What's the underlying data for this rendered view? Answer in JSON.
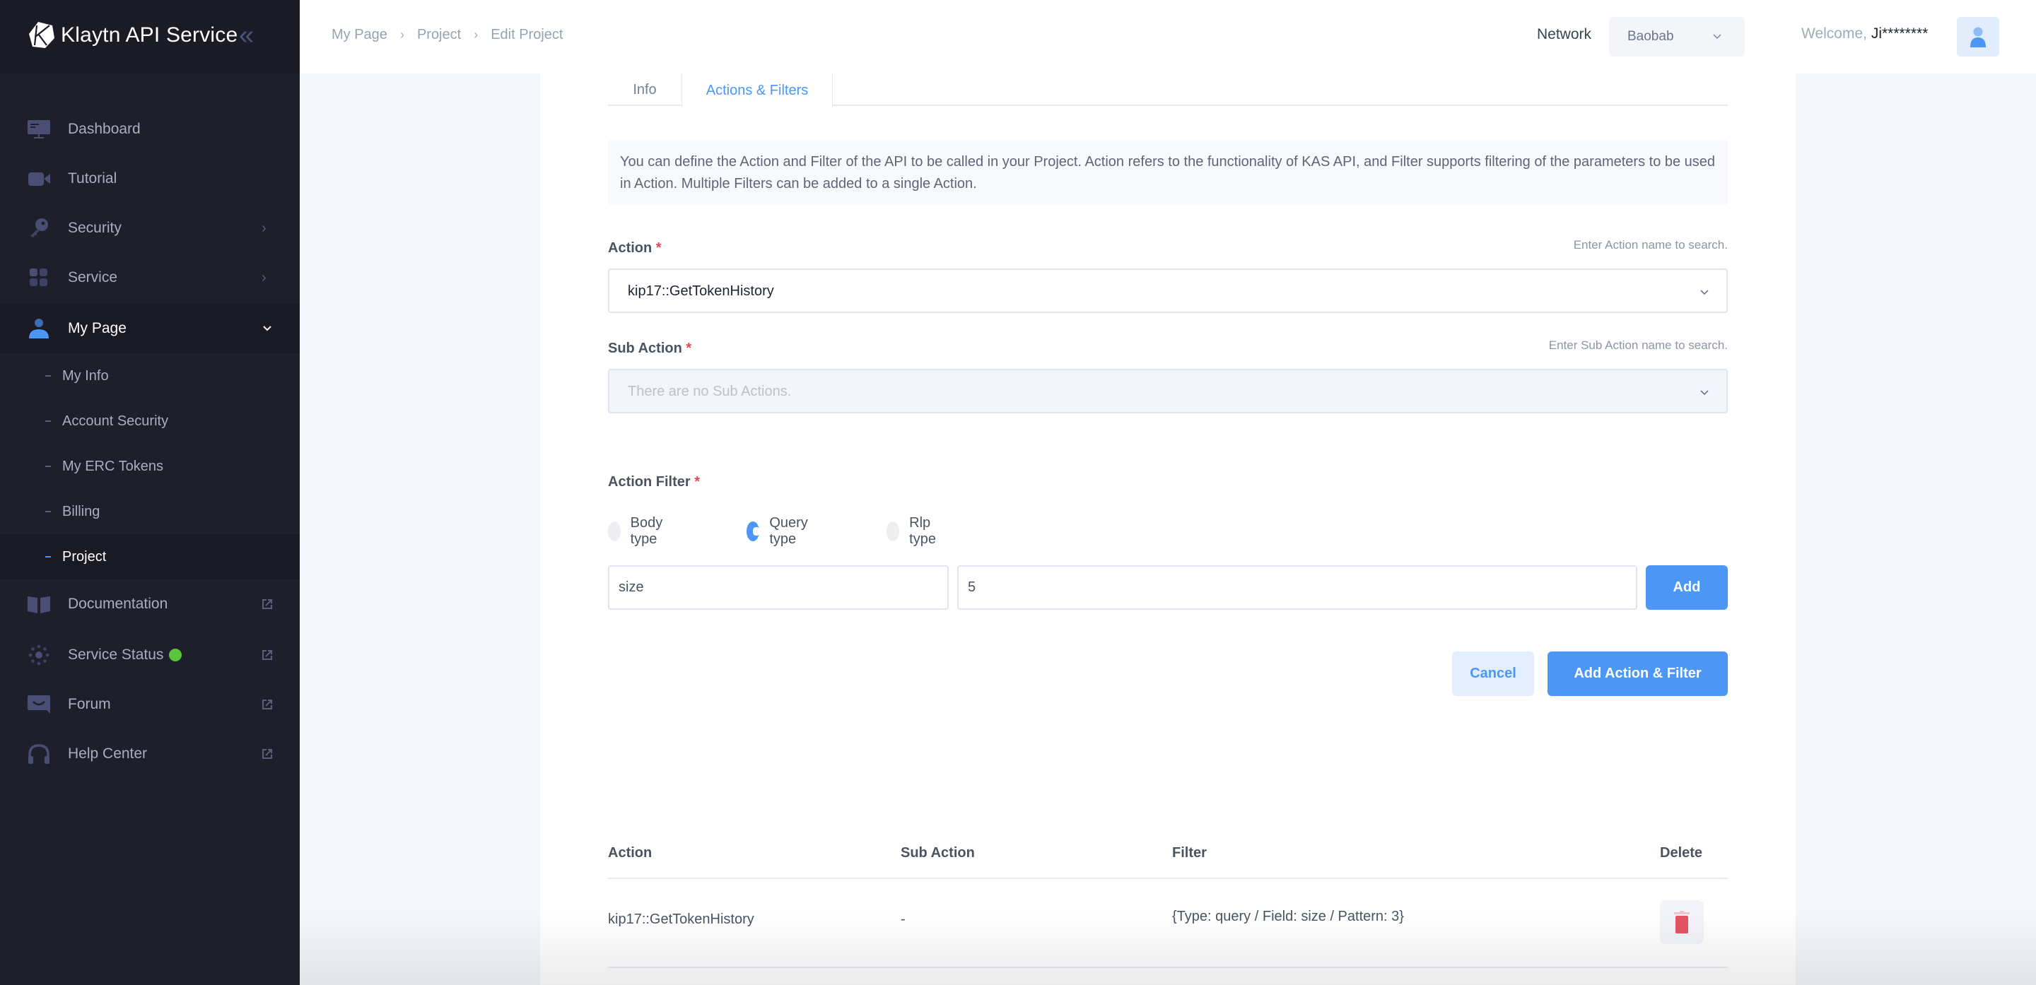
{
  "app": {
    "title": "Klaytn API Service"
  },
  "sidebar": {
    "items": [
      {
        "label": "Dashboard",
        "icon": "monitor-icon"
      },
      {
        "label": "Tutorial",
        "icon": "video-camera-icon"
      },
      {
        "label": "Security",
        "icon": "key-icon",
        "right": "chevron-right-icon"
      },
      {
        "label": "Service",
        "icon": "grid-icon",
        "right": "chevron-right-icon"
      },
      {
        "label": "My Page",
        "icon": "user-icon",
        "right": "chevron-down-icon",
        "active": true
      },
      {
        "label": "Documentation",
        "icon": "book-icon",
        "right": "external-link-icon"
      },
      {
        "label": "Service Status",
        "icon": "sun-status-icon",
        "right": "external-link-icon",
        "status_color": "#5ac43a"
      },
      {
        "label": "Forum",
        "icon": "chat-icon",
        "right": "external-link-icon"
      },
      {
        "label": "Help Center",
        "icon": "headphones-icon",
        "right": "external-link-icon"
      }
    ],
    "sub_items": [
      {
        "label": "My Info"
      },
      {
        "label": "Account Security"
      },
      {
        "label": "My ERC Tokens"
      },
      {
        "label": "Billing"
      },
      {
        "label": "Project",
        "active": true
      }
    ]
  },
  "header": {
    "breadcrumb": [
      "My Page",
      "Project",
      "Edit Project"
    ],
    "network_label": "Network",
    "network_value": "Baobab",
    "welcome_prefix": "Welcome,",
    "username": "Ji********"
  },
  "tabs": [
    {
      "label": "Info",
      "active": false
    },
    {
      "label": "Actions & Filters",
      "active": true
    }
  ],
  "info_text": "You can define the Action and Filter of the API to be called in your Project. Action refers to the functionality of KAS API, and Filter supports filtering of the parameters to be used in Action. Multiple Filters can be added to a single Action.",
  "form": {
    "action": {
      "label": "Action",
      "required": "*",
      "hint": "Enter Action name to search.",
      "value": "kip17::GetTokenHistory"
    },
    "sub_action": {
      "label": "Sub Action",
      "required": "*",
      "hint": "Enter Sub Action name to search.",
      "placeholder": "There are no Sub Actions."
    },
    "action_filter": {
      "label": "Action Filter",
      "required": "*",
      "types": [
        {
          "label": "Body type",
          "selected": false
        },
        {
          "label": "Query type",
          "selected": true
        },
        {
          "label": "Rlp type",
          "selected": false
        }
      ],
      "field_value": "size",
      "pattern_value": "5",
      "add_label": "Add"
    },
    "cancel_label": "Cancel",
    "submit_label": "Add Action & Filter"
  },
  "table": {
    "headers": [
      "Action",
      "Sub Action",
      "Filter",
      "Delete"
    ],
    "rows": [
      {
        "action": "kip17::GetTokenHistory",
        "sub_action": "-",
        "filter": "{Type: query / Field: size / Pattern: 3}"
      }
    ]
  },
  "colors": {
    "accent": "#4c96f5",
    "danger": "#e25563",
    "sidebar_bg": "#1f1f2c",
    "status_ok": "#5ac43a"
  }
}
